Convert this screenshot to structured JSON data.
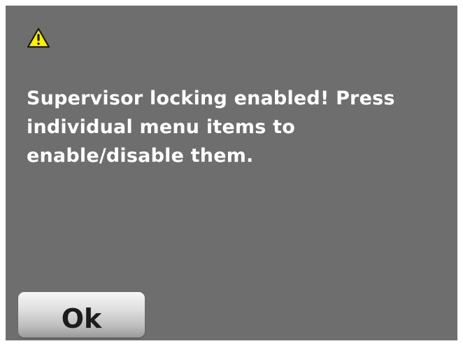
{
  "dialog": {
    "icon": "warning-icon",
    "message": "Supervisor locking enabled! Press\nindividual menu items to\nenable/disable them.",
    "ok_label": "Ok"
  },
  "colors": {
    "dialog_background": "#6e6e6e",
    "message_text": "#ffffff",
    "warning_fill": "#ffee00",
    "button_text": "#1c1c1c"
  }
}
